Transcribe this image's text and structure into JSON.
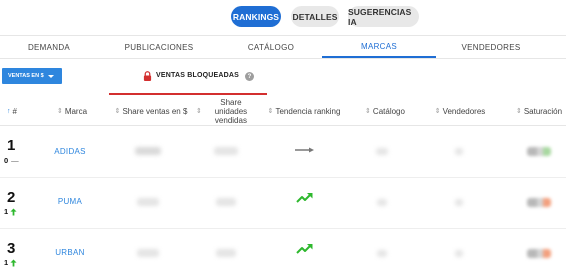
{
  "top_buttons": [
    {
      "label": "RANKINGS",
      "active": true
    },
    {
      "label": "DETALLES",
      "active": false
    },
    {
      "label": "SUGERENCIAS IA",
      "active": false
    }
  ],
  "tabs": [
    {
      "label": "DEMANDA",
      "active": false
    },
    {
      "label": "PUBLICACIONES",
      "active": false
    },
    {
      "label": "CATÁLOGO",
      "active": false
    },
    {
      "label": "MARCAS",
      "active": true
    },
    {
      "label": "VENDEDORES",
      "active": false
    }
  ],
  "filter": {
    "label": "VENTAS EN $"
  },
  "locked_notice": {
    "label": "VENTAS BLOQUEADAS",
    "help": "?"
  },
  "columns": {
    "rank": "#",
    "brand": "Marca",
    "share_sales": "Share ventas en $",
    "share_units": "Share unidades vendidas",
    "trend": "Tendencia ranking",
    "catalog": "Catálogo",
    "sellers": "Vendedores",
    "saturation": "Saturación"
  },
  "rows": [
    {
      "rank": "1",
      "change": "0",
      "change_dir": "none",
      "change_symbol": "—",
      "brand": "ADIDAS",
      "trend": "flat"
    },
    {
      "rank": "2",
      "change": "1",
      "change_dir": "up",
      "change_symbol": "",
      "brand": "PUMA",
      "trend": "up"
    },
    {
      "rank": "3",
      "change": "1",
      "change_dir": "up",
      "change_symbol": "",
      "brand": "URBAN",
      "trend": "up"
    }
  ],
  "colors": {
    "primary": "#1f6ed4",
    "link": "#2e86de",
    "locked_accent": "#d32f2f",
    "trend_up": "#2eb82e",
    "trend_flat": "#777777"
  }
}
